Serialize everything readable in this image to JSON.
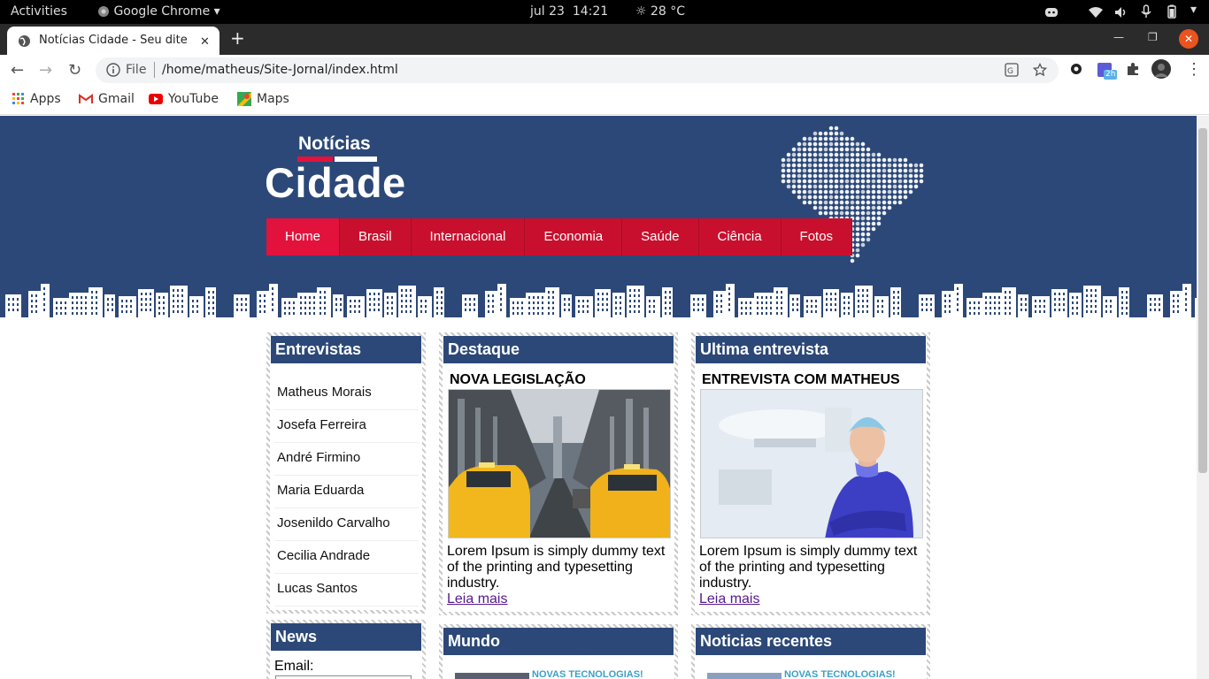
{
  "system_bar": {
    "activities": "Activities",
    "app_name": "Google Chrome",
    "date": "jul 23",
    "time": "14:21",
    "weather": "28 °C"
  },
  "browser": {
    "tab_title": "Notícias Cidade - Seu dite",
    "file_label": "File",
    "url": "/home/matheus/Site-Jornal/index.html",
    "badge": "2h"
  },
  "bookmarks": [
    {
      "label": "Apps",
      "icon": "apps-grid-icon"
    },
    {
      "label": "Gmail",
      "icon": "gmail-icon"
    },
    {
      "label": "YouTube",
      "icon": "youtube-icon"
    },
    {
      "label": "Maps",
      "icon": "maps-icon"
    }
  ],
  "site": {
    "logo_top": "Notícias",
    "logo_main": "Cidade",
    "menu": [
      "Home",
      "Brasil",
      "Internacional",
      "Economia",
      "Saúde",
      "Ciência",
      "Fotos"
    ],
    "active_menu": "Home",
    "colors": {
      "header": "#2c4878",
      "menu_red": "#c8102e",
      "accent": "#e3123d"
    }
  },
  "sidebar": {
    "entrevistas_title": "Entrevistas",
    "people": [
      "Matheus Morais",
      "Josefa Ferreira",
      "André Firmino",
      "Maria Eduarda",
      "Josenildo Carvalho",
      "Cecilia Andrade",
      "Lucas Santos"
    ],
    "news_title": "News",
    "email_label": "Email:"
  },
  "destaque": {
    "title": "Destaque",
    "article_title": "NOVA LEGISLAÇÃO",
    "text": "Lorem Ipsum is simply dummy text of the printing and typesetting industry.",
    "link": "Leia mais"
  },
  "ultima": {
    "title": "Ultima entrevista",
    "article_title": "ENTREVISTA COM MATHEUS",
    "text": "Lorem Ipsum is simply dummy text of the printing and typesetting industry.",
    "link": "Leia mais"
  },
  "mundo": {
    "title": "Mundo",
    "item_title": "NOVAS TECNOLOGIAS!"
  },
  "recentes": {
    "title": "Noticias recentes",
    "item_title": "NOVAS TECNOLOGIAS!"
  }
}
